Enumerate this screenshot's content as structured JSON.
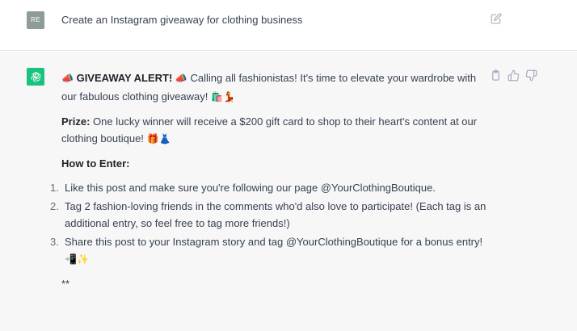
{
  "user_message": {
    "avatar_initials": "RE",
    "text": "Create an Instagram giveaway for clothing business"
  },
  "assistant_message": {
    "p1_emoji_start": "📣",
    "p1_title": "GIVEAWAY ALERT!",
    "p1_emoji_mid": "📣",
    "p1_text": "Calling all fashionistas! It's time to elevate your wardrobe with our fabulous clothing giveaway!",
    "p1_emoji_end": "🛍️💃",
    "prize_label": "Prize:",
    "prize_text": "One lucky winner will receive a $200 gift card to shop to their heart's content at our clothing boutique!",
    "prize_emoji": "🎁👗",
    "how_to_enter": "How to Enter:",
    "steps": [
      {
        "num": "1.",
        "text": "Like this post and make sure you're following our page @YourClothingBoutique."
      },
      {
        "num": "2.",
        "text": "Tag 2 fashion-loving friends in the comments who'd also love to participate! (Each tag is an additional entry, so feel free to tag more friends!)"
      },
      {
        "num": "3.",
        "text": "Share this post to your Instagram story and tag @YourClothingBoutique for a bonus entry!",
        "emoji": "📲✨"
      }
    ],
    "tail": "**"
  },
  "icons": {
    "edit": "edit-icon",
    "copy": "copy-icon",
    "thumbs_up": "thumbs-up-icon",
    "thumbs_down": "thumbs-down-icon",
    "bot_logo": "openai-logo-icon"
  },
  "colors": {
    "bot_avatar_bg": "#19c37d",
    "user_avatar_bg": "#8e9b98",
    "assistant_row_bg": "#f7f7f8"
  }
}
